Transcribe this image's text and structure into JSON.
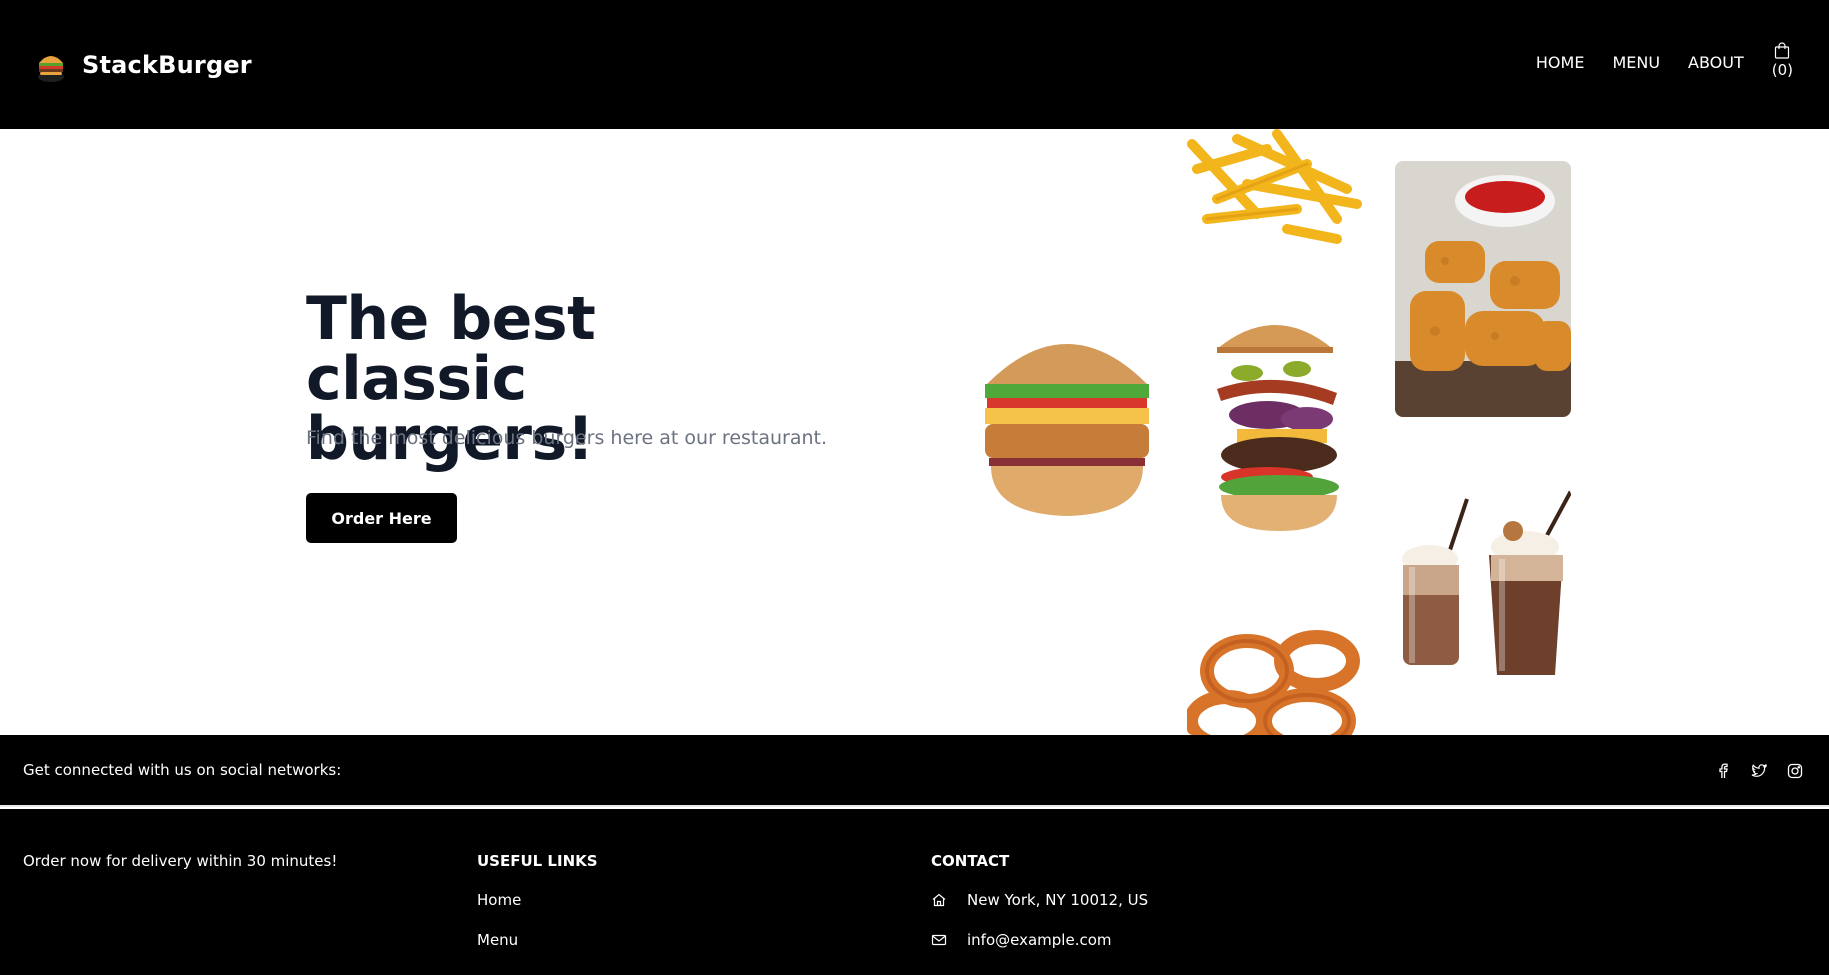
{
  "header": {
    "brand_name": "StackBurger",
    "nav": [
      {
        "label": "HOME"
      },
      {
        "label": "MENU"
      },
      {
        "label": "ABOUT"
      }
    ],
    "cart_count": "(0)",
    "cart_icon": "shopping-bag-icon",
    "logo_icon": "burger-logo-icon"
  },
  "hero": {
    "title": "The best classic burgers!",
    "subtitle": "Find the most delicious burgers here at our restaurant.",
    "cta_label": "Order Here",
    "images": [
      "fries",
      "ketchup-nuggets",
      "crispy-chicken-burger",
      "stacked-burger",
      "milkshakes",
      "onion-rings"
    ]
  },
  "social": {
    "text": "Get connected with us on social networks:",
    "icons": [
      "facebook-icon",
      "twitter-icon",
      "instagram-icon"
    ]
  },
  "footer": {
    "tagline": "Order now for delivery within 30 minutes!",
    "useful_links_heading": "USEFUL LINKS",
    "links": [
      {
        "label": "Home"
      },
      {
        "label": "Menu"
      }
    ],
    "contact_heading": "CONTACT",
    "contact": [
      {
        "icon": "home-icon",
        "text": "New York, NY 10012, US"
      },
      {
        "icon": "mail-icon",
        "text": "info@example.com"
      }
    ]
  },
  "colors": {
    "header_bg": "#000000",
    "title_color": "#111827",
    "subtitle_color": "#6b7280",
    "button_bg": "#000000"
  }
}
